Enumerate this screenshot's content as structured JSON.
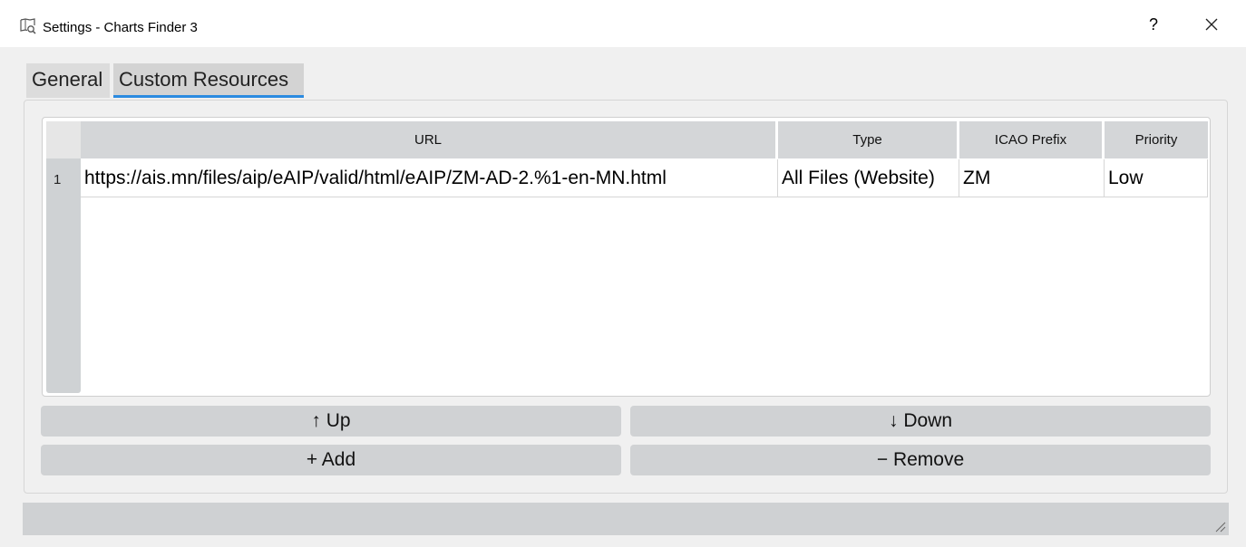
{
  "window": {
    "title": "Settings - Charts Finder 3",
    "help_label": "?",
    "icons": {
      "app": "charts-finder-app-icon",
      "close": "close-icon"
    }
  },
  "tabs": [
    {
      "label": "General",
      "selected": false
    },
    {
      "label": "Custom Resources",
      "selected": true
    }
  ],
  "table": {
    "columns": [
      "URL",
      "Type",
      "ICAO Prefix",
      "Priority"
    ],
    "rows": [
      {
        "number": "1",
        "url": "https://ais.mn/files/aip/eAIP/valid/html/eAIP/ZM-AD-2.%1-en-MN.html",
        "type": "All Files (Website)",
        "icao_prefix": "ZM",
        "priority": "Low"
      }
    ]
  },
  "buttons": {
    "up": "↑ Up",
    "down": "↓ Down",
    "add": "+ Add",
    "remove": "− Remove"
  },
  "colors": {
    "tab_accent": "#2b8be0"
  }
}
